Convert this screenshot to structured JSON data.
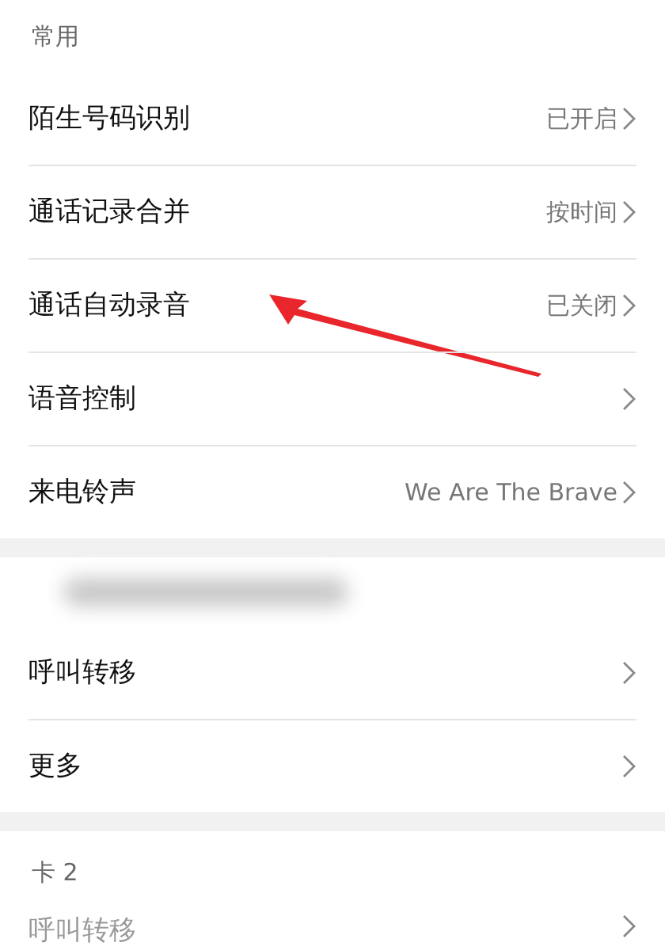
{
  "sections": [
    {
      "kind": "titled",
      "header": "常用",
      "items": [
        {
          "label": "陌生号码识别",
          "value": "已开启",
          "disabled": false,
          "annotated": false
        },
        {
          "label": "通话记录合并",
          "value": "按时间",
          "disabled": false,
          "annotated": false
        },
        {
          "label": "通话自动录音",
          "value": "已关闭",
          "disabled": false,
          "annotated": true
        },
        {
          "label": "语音控制",
          "disabled": false,
          "annotated": false
        },
        {
          "label": "来电铃声",
          "value": "We Are The Brave",
          "disabled": false,
          "annotated": false
        }
      ]
    },
    {
      "kind": "blurred",
      "items": [
        {
          "label": "呼叫转移",
          "disabled": false,
          "annotated": false
        },
        {
          "label": "更多",
          "disabled": false,
          "annotated": false
        }
      ]
    },
    {
      "kind": "titled",
      "header": "卡 2",
      "items": [
        {
          "label": "呼叫转移",
          "disabled": true,
          "annotated": false
        }
      ]
    }
  ]
}
